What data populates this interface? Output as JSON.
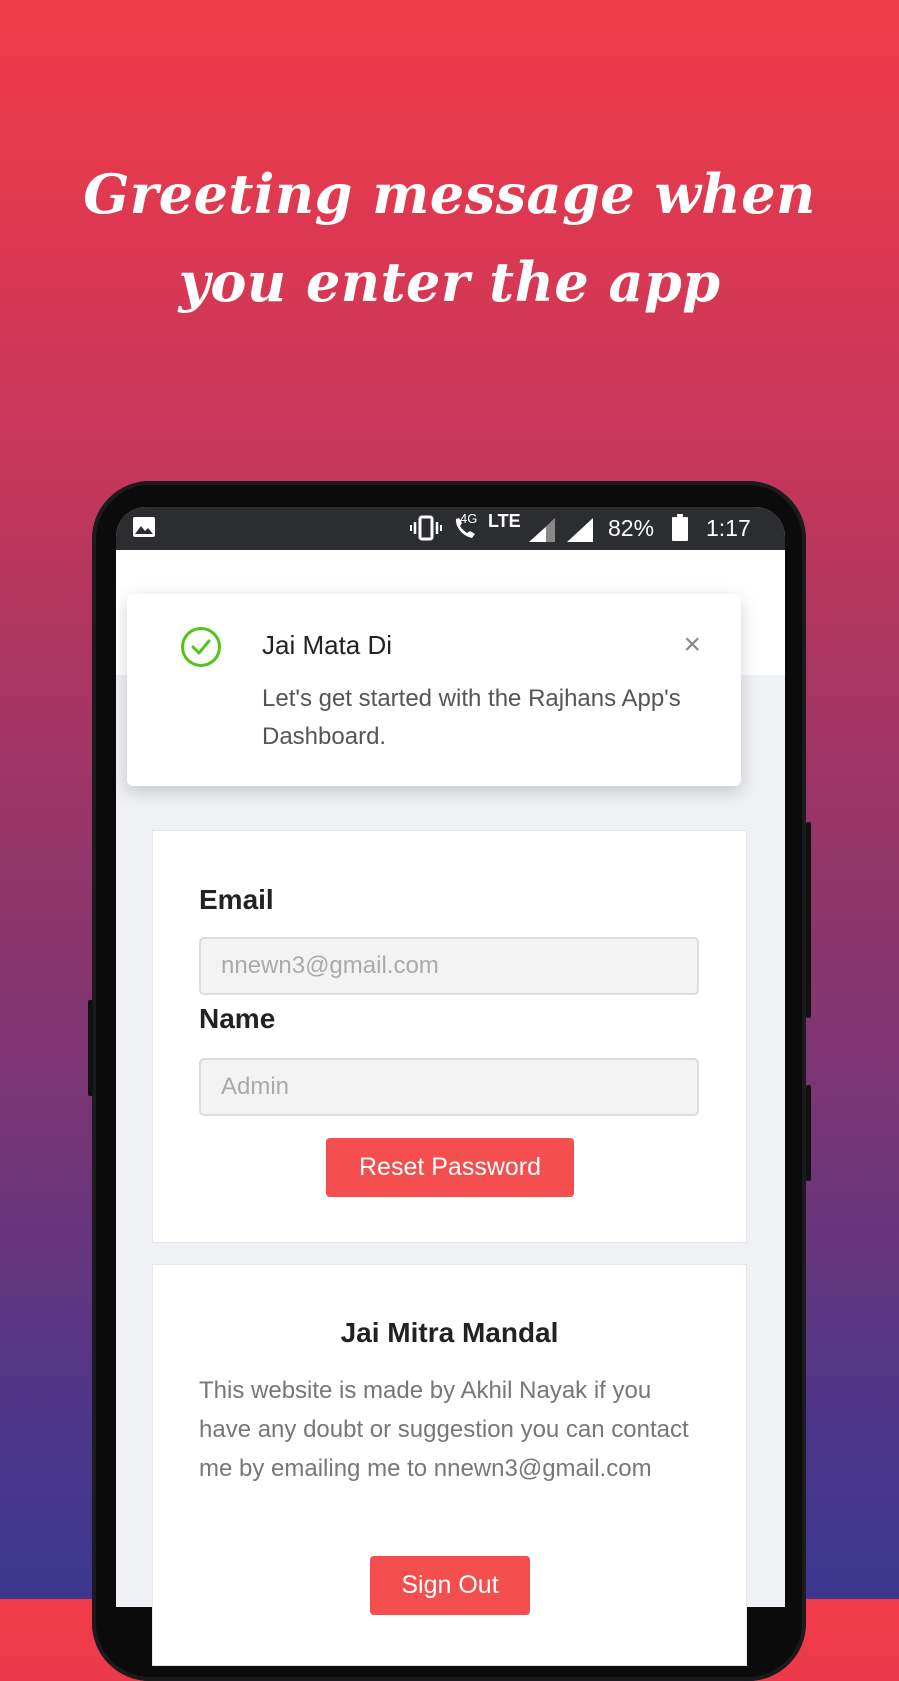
{
  "headline": "Greeting message when you enter the app",
  "statusbar": {
    "network": "4G",
    "lte": "LTE",
    "battery": "82%",
    "time": "1:17"
  },
  "toast": {
    "title": "Jai Mata Di",
    "message": "Let's get started with the Rajhans App's Dashboard.",
    "close": "×"
  },
  "profile": {
    "email_label": "Email",
    "email_placeholder": "nnewn3@gmail.com",
    "name_label": "Name",
    "name_placeholder": "Admin",
    "reset_button": "Reset Password"
  },
  "about": {
    "title": "Jai Mitra Mandal",
    "text": "This website is made by Akhil Nayak if you have any doubt or suggestion you can contact me by emailing me to nnewn3@gmail.com",
    "signout_button": "Sign Out"
  },
  "colors": {
    "accent": "#f44e4e",
    "success": "#52c41a"
  }
}
